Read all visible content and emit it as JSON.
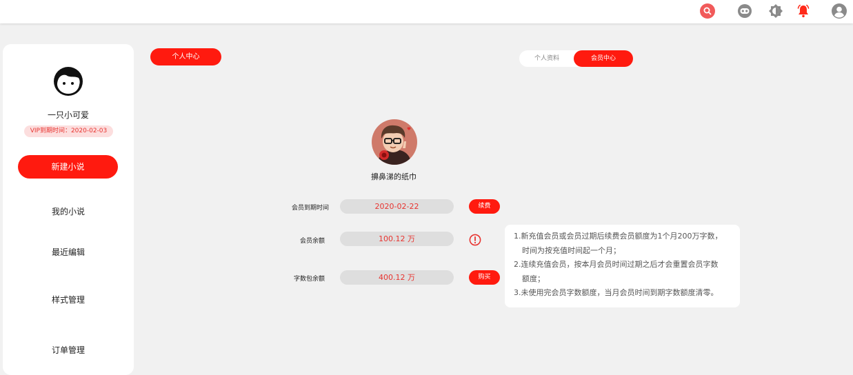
{
  "header": {
    "icons": [
      "search-icon",
      "robot-face-icon",
      "brightness-icon",
      "bell-alarm-icon",
      "user-account-icon"
    ],
    "colors": {
      "accent": "#ff1a0f",
      "search_bg": "#f15a5a"
    }
  },
  "sidebar": {
    "username": "一只小可爱",
    "vip_expiry": "VIP到期时间：2020-02-03",
    "new_novel": "新建小说",
    "items": [
      {
        "label": "我的小说"
      },
      {
        "label": "最近编辑"
      },
      {
        "label": "样式管理"
      },
      {
        "label": "订单管理"
      }
    ]
  },
  "main": {
    "section_title": "个人中心",
    "tabs": [
      {
        "label": "个人资料",
        "active": false
      },
      {
        "label": "会员中心",
        "active": true
      }
    ],
    "profile": {
      "name": "擤鼻涕的纸巾"
    },
    "rows": [
      {
        "label": "会员到期时间",
        "value": "2020-02-22",
        "action": "续费"
      },
      {
        "label": "会员余额",
        "value": "100.12 万",
        "action_icon": "info-icon"
      },
      {
        "label": "字数包余额",
        "value": "400.12 万",
        "action": "购买"
      }
    ],
    "notes": [
      "1.新充值会员或会员过期后续费会员额度为1个月200万字数，",
      "时间为按充值时间起一个月；",
      "2.连续充值会员，按本月会员时间过期之后才会重置会员字数",
      "额度；",
      "3.未使用完会员字数额度，当月会员时间到期字数额度清零。"
    ]
  }
}
